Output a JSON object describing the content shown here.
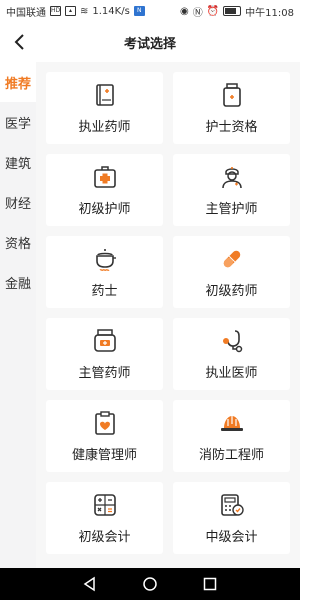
{
  "status": {
    "carrier": "中国联通",
    "speed": "1.14K/s",
    "time": "中午11:08"
  },
  "header": {
    "title": "考试选择",
    "back_icon": "chevron-left-icon"
  },
  "sidebar": {
    "items": [
      {
        "label": "推荐",
        "active": true
      },
      {
        "label": "医学",
        "active": false
      },
      {
        "label": "建筑",
        "active": false
      },
      {
        "label": "财经",
        "active": false
      },
      {
        "label": "资格",
        "active": false
      },
      {
        "label": "金融",
        "active": false
      }
    ]
  },
  "exams": [
    {
      "label": "执业药师",
      "icon": "medicine-book-icon"
    },
    {
      "label": "护士资格",
      "icon": "medicine-bottle-icon"
    },
    {
      "label": "初级护师",
      "icon": "first-aid-kit-icon"
    },
    {
      "label": "主管护师",
      "icon": "nurse-icon"
    },
    {
      "label": "药士",
      "icon": "decoction-pot-icon"
    },
    {
      "label": "初级药师",
      "icon": "pill-capsule-icon"
    },
    {
      "label": "主管药师",
      "icon": "medicine-jar-icon"
    },
    {
      "label": "执业医师",
      "icon": "stethoscope-icon"
    },
    {
      "label": "健康管理师",
      "icon": "health-clipboard-icon"
    },
    {
      "label": "消防工程师",
      "icon": "safety-helmet-icon"
    },
    {
      "label": "初级会计",
      "icon": "calculator-icon"
    },
    {
      "label": "中级会计",
      "icon": "calculator-check-icon"
    }
  ],
  "colors": {
    "accent": "#f07b24",
    "icon_stroke": "#333333"
  }
}
